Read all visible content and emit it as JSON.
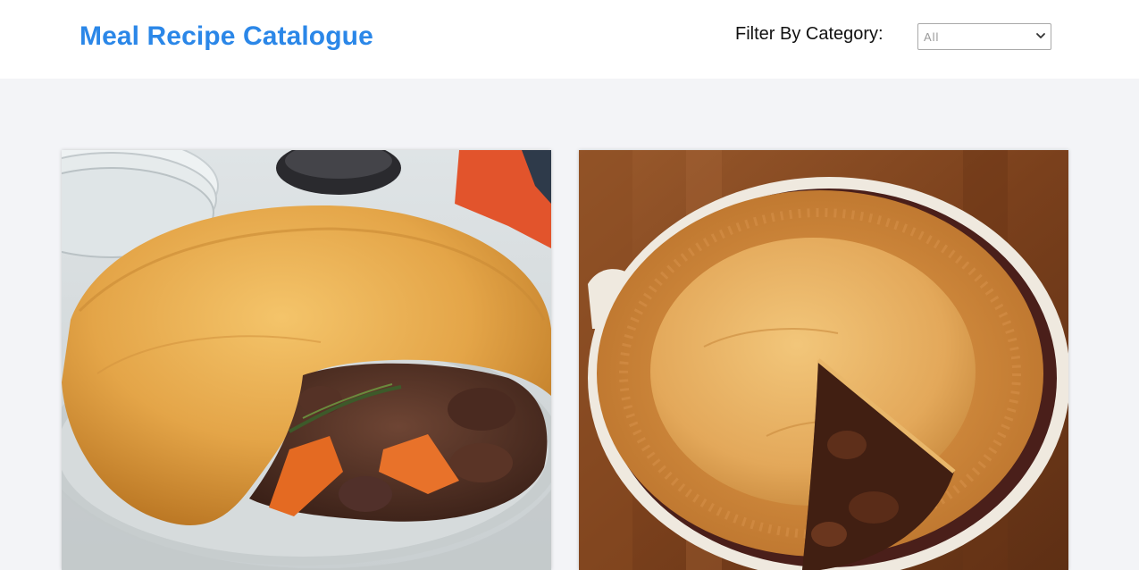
{
  "header": {
    "title": "Meal Recipe Catalogue",
    "filter_label": "Filter By Category:",
    "filter_selected": "All",
    "filter_options": [
      "All"
    ]
  },
  "recipes": [
    {
      "image_subject": "beef pie with carrots and thyme in white dish"
    },
    {
      "image_subject": "steak pie with slice removed in ceramic dish"
    }
  ],
  "colors": {
    "brand": "#2b87e8",
    "page_background": "#f3f4f7",
    "header_background": "#ffffff"
  }
}
